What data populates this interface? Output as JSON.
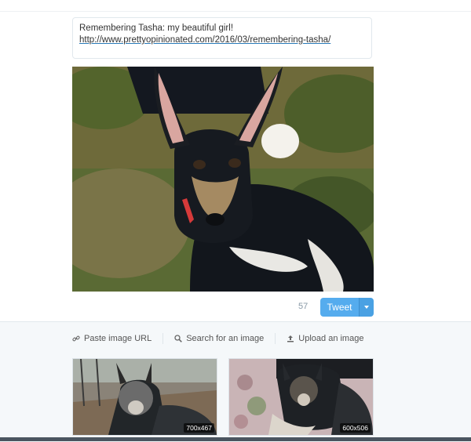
{
  "compose": {
    "text_line1": "Remembering Tasha: my beautiful girl!",
    "link": "http://www.prettyopinionated.com/2016/03/remembering-tasha/"
  },
  "tweet_bar": {
    "count": "57",
    "tweet_label": "Tweet"
  },
  "media": {
    "tabs": [
      {
        "label": "Paste image URL",
        "icon": "link-icon"
      },
      {
        "label": "Search for an image",
        "icon": "search-icon"
      },
      {
        "label": "Upload an image",
        "icon": "upload-icon"
      }
    ],
    "thumbnails": [
      {
        "dimensions": "700x467"
      },
      {
        "dimensions": "600x506"
      }
    ]
  },
  "colors": {
    "accent": "#55acee",
    "panel_bg": "#f5f8fa"
  }
}
